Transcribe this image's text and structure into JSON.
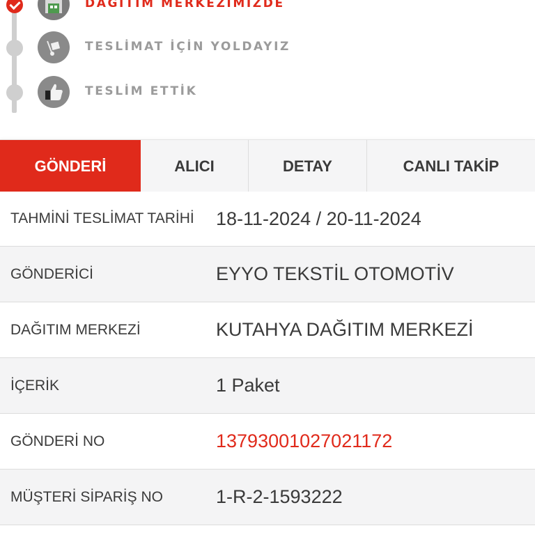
{
  "timeline": {
    "steps": [
      {
        "label": "DAĞITIM MERKEZİMİZDE",
        "status": "done",
        "icon": "warehouse-icon"
      },
      {
        "label": "TESLİMAT İÇİN YOLDAYIZ",
        "status": "pending",
        "icon": "hand-truck-icon"
      },
      {
        "label": "TESLİM ETTİK",
        "status": "pending",
        "icon": "thumbs-up-icon"
      }
    ]
  },
  "tabs": [
    {
      "label": "GÖNDERİ",
      "active": true
    },
    {
      "label": "ALICI",
      "active": false
    },
    {
      "label": "DETAY",
      "active": false
    },
    {
      "label": "CANLI TAKİP",
      "active": false
    }
  ],
  "info": {
    "rows": [
      {
        "key": "TAHMİNİ TESLİMAT TARİHİ",
        "value": "18-11-2024 / 20-11-2024"
      },
      {
        "key": "GÖNDERİCİ",
        "value": "EYYO TEKSTİL OTOMOTİV"
      },
      {
        "key": "DAĞITIM MERKEZİ",
        "value": "KUTAHYA DAĞITIM MERKEZİ"
      },
      {
        "key": "İÇERİK",
        "value": "1 Paket"
      },
      {
        "key": "GÖNDERİ NO",
        "value": "13793001027021172"
      },
      {
        "key": "MÜŞTERİ SİPARİŞ NO",
        "value": "1-R-2-1593222"
      }
    ]
  },
  "colors": {
    "accent": "#e02a1b",
    "inactive": "#9b9b9b",
    "timeline_line": "#cfcfcf"
  }
}
